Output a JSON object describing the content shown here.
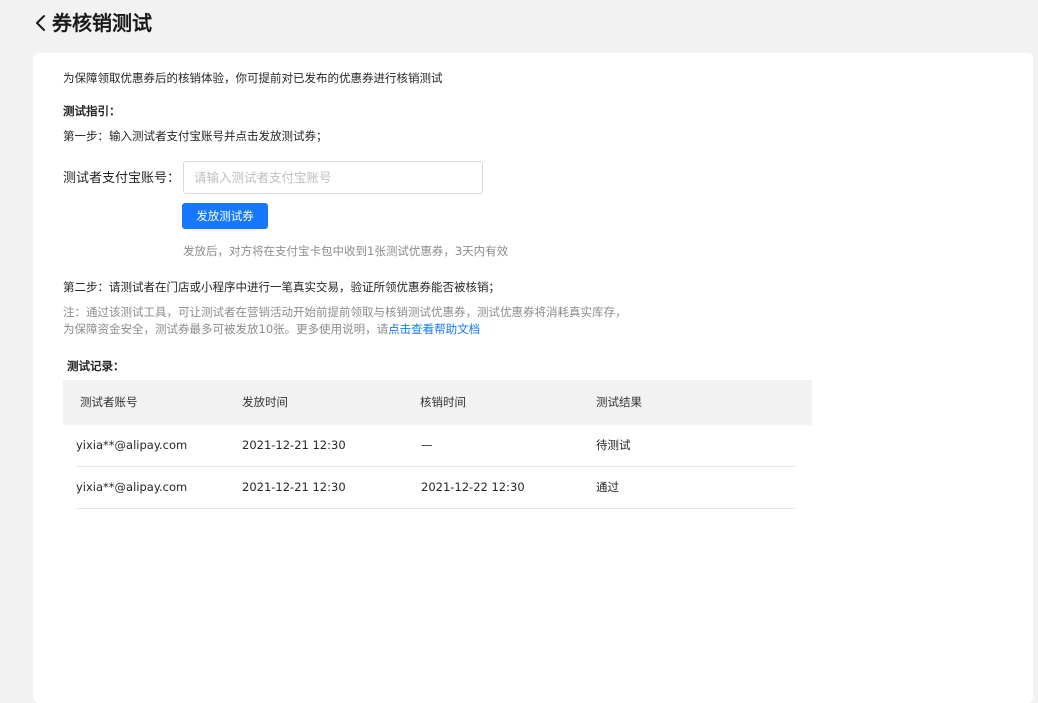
{
  "header": {
    "title": "券核销测试"
  },
  "intro": "为保障领取优惠券后的核销体验，你可提前对已发布的优惠券进行核销测试",
  "guide": {
    "title": "测试指引：",
    "step1": "第一步：输入测试者支付宝账号并点击发放测试券；",
    "field_label": "测试者支付宝账号：",
    "input_placeholder": "请输入测试者支付宝账号",
    "input_value": "",
    "issue_button": "发放测试券",
    "issue_hint": "发放后，对方将在支付宝卡包中收到1张测试优惠券，3天内有效",
    "step2": "第二步：请测试者在门店或小程序中进行一笔真实交易，验证所领优惠券能否被核销；",
    "note_line1": "注：通过该测试工具，可让测试者在营销活动开始前提前领取与核销测试优惠券，测试优惠券将消耗真实库存，",
    "note_line2_prefix": "为保障资金安全，测试券最多可被发放10张。更多使用说明，请",
    "help_link": "点击查看帮助文档"
  },
  "records": {
    "title": "测试记录：",
    "columns": [
      "测试者账号",
      "发放时间",
      "核销时间",
      "测试结果"
    ],
    "rows": [
      {
        "account": "yixia**@alipay.com",
        "issued": "2021-12-21 12:30",
        "verified": "—",
        "result": "待测试"
      },
      {
        "account": "yixia**@alipay.com",
        "issued": "2021-12-21 12:30",
        "verified": "2021-12-22 12:30",
        "result": "通过"
      }
    ]
  },
  "colors": {
    "accent": "#1677ff",
    "background": "#f2f2f2",
    "muted_text": "#8c8c8c"
  }
}
